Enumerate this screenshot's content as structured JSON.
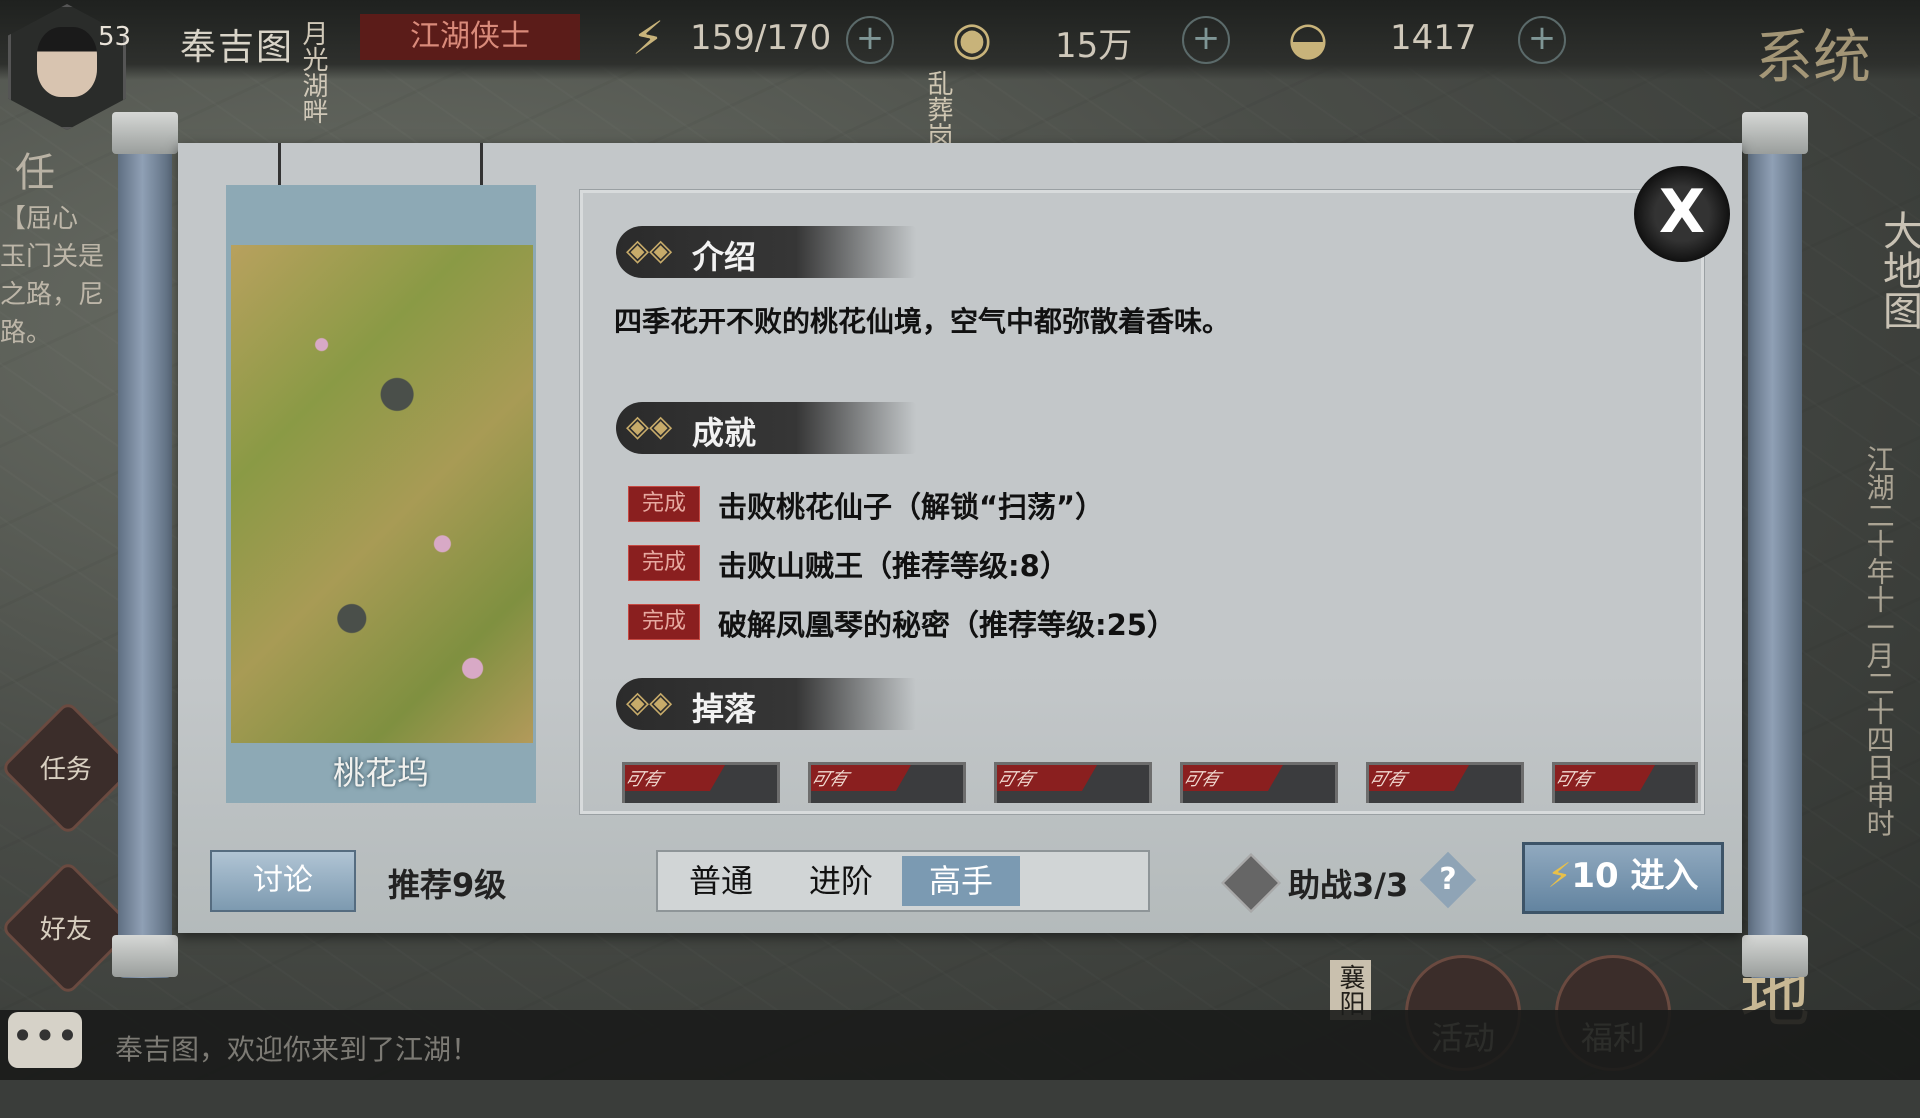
{
  "player": {
    "level": "53",
    "name": "奉吉图",
    "rank": "江湖侠士"
  },
  "resources": {
    "energy": {
      "icon": "lightning-icon",
      "value": "159/170"
    },
    "coins": {
      "icon": "coin-icon",
      "value": "15万"
    },
    "ingots": {
      "icon": "gold-ingot-icon",
      "value": "1417"
    }
  },
  "map_tags": {
    "tag1": "月光湖畔",
    "tag2": "乱葬岗"
  },
  "system_label": "系统",
  "world_map_label": "大地图",
  "date": "江湖二十年十一月二十四日申时",
  "left_panel": {
    "quest_short": "任",
    "quest_title": "【屈心",
    "quest_desc": "玉门关是之路，尼路。"
  },
  "scene": {
    "name": "桃花坞",
    "intro_title": "介绍",
    "intro_text": "四季花开不败的桃花仙境，空气中都弥散着香味。",
    "achievements_title": "成就",
    "achievements": [
      {
        "status": "完成",
        "text": "击败桃花仙子（解锁“扫荡”）"
      },
      {
        "status": "完成",
        "text": "击败山贼王（推荐等级:8）"
      },
      {
        "status": "完成",
        "text": "破解凤凰琴的秘密（推荐等级:25）"
      }
    ],
    "drops_title": "掉落",
    "drop_tag": "可有"
  },
  "footer": {
    "discuss": "讨论",
    "recommend": "推荐9级",
    "difficulty": [
      "普通",
      "进阶",
      "高手"
    ],
    "active_difficulty": "高手",
    "assist": "助战3/3",
    "help": "?",
    "enter_cost": "10",
    "enter": "进入"
  },
  "buttons": {
    "task": "任务",
    "friends": "好友",
    "activity": "活动",
    "welfare": "福利",
    "ground": "地"
  },
  "xiangyang": "襄阳",
  "chat": {
    "message": "奉吉图，欢迎你来到了江湖！"
  }
}
